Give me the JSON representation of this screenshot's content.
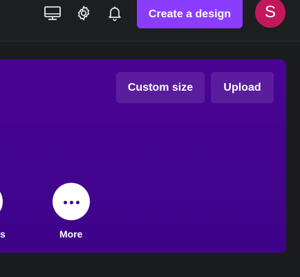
{
  "topbar": {
    "icons": [
      "desktop-icon",
      "gear-icon",
      "bell-icon"
    ],
    "create_button_label": "Create a design",
    "avatar_initial": "S"
  },
  "hero": {
    "buttons": {
      "custom_size_label": "Custom size",
      "upload_label": "Upload"
    },
    "quick_actions": [
      {
        "label": "s",
        "icon": "partial-circle-icon"
      },
      {
        "label": "More",
        "icon": "more-dots-icon"
      }
    ]
  },
  "colors": {
    "accent": "#8b3dff",
    "avatar_bg": "#c2185b",
    "hero_bg": "#43048e",
    "page_bg": "#1b1c1e"
  }
}
